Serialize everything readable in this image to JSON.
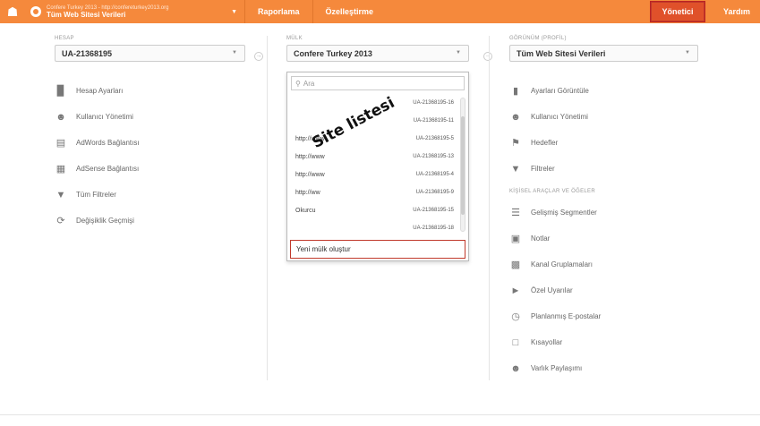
{
  "topbar": {
    "account_url_line": "Confere Turkey 2013 - http://confereturkey2013.org",
    "account_view_line": "Tüm Web Sitesi Verileri",
    "nav_reporting": "Raporlama",
    "nav_customization": "Özelleştirme",
    "admin": "Yönetici",
    "help": "Yardım"
  },
  "account": {
    "label": "HESAP",
    "selected": "UA-21368195",
    "items": [
      {
        "label": "Hesap Ayarları",
        "icon": "building-icon"
      },
      {
        "label": "Kullanıcı Yönetimi",
        "icon": "users-icon"
      },
      {
        "label": "AdWords Bağlantısı",
        "icon": "adwords-icon"
      },
      {
        "label": "AdSense Bağlantısı",
        "icon": "adsense-icon"
      },
      {
        "label": "Tüm Filtreler",
        "icon": "filter-icon"
      },
      {
        "label": "Değişiklik Geçmişi",
        "icon": "history-icon"
      }
    ]
  },
  "property": {
    "label": "MÜLK",
    "selected": "Confere Turkey 2013",
    "search_value": "Ara",
    "rows": [
      {
        "name": "",
        "id": "UA-21368195-16"
      },
      {
        "name": "",
        "id": "UA-21368195-11"
      },
      {
        "name": "http://www",
        "id": "UA-21368195-5"
      },
      {
        "name": "http://www",
        "id": "UA-21368195-13"
      },
      {
        "name": "http://www",
        "id": "UA-21368195-4"
      },
      {
        "name": "http://ww",
        "id": "UA-21368195-9"
      },
      {
        "name": "Okurcu",
        "id": "UA-21368195-15"
      },
      {
        "name": "",
        "id": "UA-21368195-18"
      }
    ],
    "create_new": "Yeni mülk oluştur",
    "overlay_text": "Site listesi"
  },
  "view": {
    "label": "GÖRÜNÜM (PROFİL)",
    "selected": "Tüm Web Sitesi Verileri",
    "items": [
      {
        "label": "Ayarları Görüntüle",
        "icon": "document-icon"
      },
      {
        "label": "Kullanıcı Yönetimi",
        "icon": "users-icon"
      },
      {
        "label": "Hedefler",
        "icon": "flag-icon"
      },
      {
        "label": "Filtreler",
        "icon": "filter-icon"
      }
    ],
    "personal_label": "KİŞİSEL ARAÇLAR VE ÖĞELER",
    "personal_items": [
      {
        "label": "Gelişmiş Segmentler",
        "icon": "segments-icon"
      },
      {
        "label": "Notlar",
        "icon": "notes-icon"
      },
      {
        "label": "Kanal Gruplamaları",
        "icon": "channel-icon"
      },
      {
        "label": "Özel Uyarılar",
        "icon": "megaphone-icon"
      },
      {
        "label": "Planlanmış E-postalar",
        "icon": "clock-icon"
      },
      {
        "label": "Kısayollar",
        "icon": "shortcut-icon"
      },
      {
        "label": "Varlık Paylaşımı",
        "icon": "share-icon"
      }
    ]
  }
}
